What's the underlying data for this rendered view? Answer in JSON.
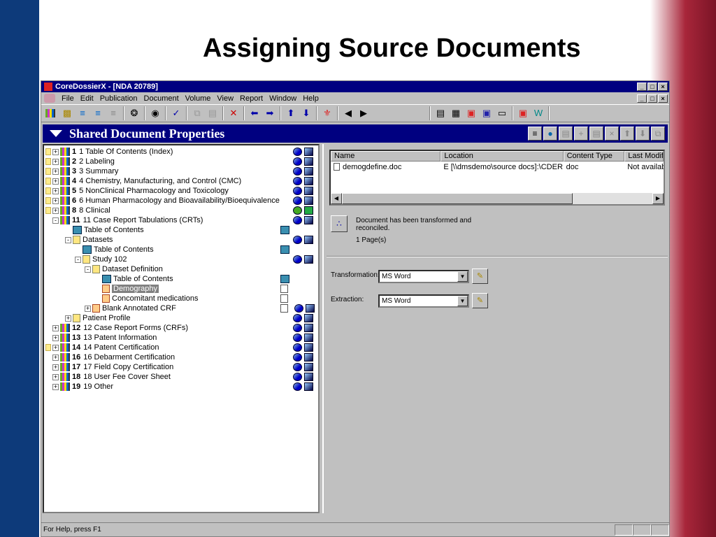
{
  "slide": {
    "title": "Assigning Source Documents"
  },
  "window": {
    "title": "CoreDossierX - [NDA 20789]",
    "controls": [
      "_",
      "ຏ",
      "×"
    ]
  },
  "menu": [
    "File",
    "Edit",
    "Publication",
    "Document",
    "Volume",
    "View",
    "Report",
    "Window",
    "Help"
  ],
  "panel": {
    "title": "Shared Document Properties"
  },
  "tree": [
    {
      "level": 0,
      "note": true,
      "num": "1",
      "label": "1 Table Of Contents (Index)",
      "icon": "volume",
      "pm": "+",
      "right": "ball-book"
    },
    {
      "level": 0,
      "note": true,
      "num": "2",
      "label": "2 Labeling",
      "icon": "volume",
      "pm": "+",
      "right": "ball-book"
    },
    {
      "level": 0,
      "note": true,
      "num": "3",
      "label": "3 Summary",
      "icon": "volume",
      "pm": "+",
      "right": "ball-book"
    },
    {
      "level": 0,
      "note": true,
      "num": "4",
      "label": "4 Chemistry, Manufacturing, and Control  (CMC)",
      "icon": "volume",
      "pm": "+",
      "right": "ball-book"
    },
    {
      "level": 0,
      "note": true,
      "num": "5",
      "label": "5 NonClinical Pharmacology and Toxicology",
      "icon": "volume",
      "pm": "+",
      "right": "ball-book"
    },
    {
      "level": 0,
      "note": true,
      "num": "6",
      "label": "6 Human Pharmacology and Bioavailability/Bioequivalence",
      "icon": "volume",
      "pm": "+",
      "right": "ball-book"
    },
    {
      "level": 0,
      "note": true,
      "num": "8",
      "label": "8 Clinical",
      "icon": "volume",
      "pm": "+",
      "right": "check-greenbook"
    },
    {
      "level": 0,
      "note": false,
      "num": "11",
      "label": "11 Case Report Tabulations (CRTs)",
      "icon": "volume",
      "pm": "-",
      "right": "ball-book"
    },
    {
      "level": 1,
      "label": "Table of Contents",
      "icon": "word",
      "right": "word"
    },
    {
      "level": 1,
      "label": "Datasets",
      "icon": "doc",
      "pm": "-",
      "right": "ball-book"
    },
    {
      "level": 2,
      "label": "Table of Contents",
      "icon": "word",
      "right": "word"
    },
    {
      "level": 2,
      "label": "Study 102",
      "icon": "doc",
      "pm": "-",
      "right": "ball-book"
    },
    {
      "level": 3,
      "label": "Dataset Definition",
      "icon": "doc",
      "pm": "-"
    },
    {
      "level": 4,
      "label": "Table of Contents",
      "icon": "word",
      "right": "word"
    },
    {
      "level": 4,
      "label": "Demography",
      "icon": "pdf",
      "selected": true,
      "right": "page"
    },
    {
      "level": 4,
      "label": "Concomitant medications",
      "icon": "pdf",
      "right": "page"
    },
    {
      "level": 3,
      "label": "Blank Annotated CRF",
      "icon": "pdf",
      "pm": "+",
      "right": "page-ball-book"
    },
    {
      "level": 1,
      "label": "Patient Profile",
      "icon": "doc",
      "pm": "+",
      "right": "ball-book"
    },
    {
      "level": 0,
      "note": false,
      "num": "12",
      "label": "12 Case Report Forms (CRFs)",
      "icon": "volume",
      "pm": "+",
      "right": "ball-book"
    },
    {
      "level": 0,
      "note": false,
      "num": "13",
      "label": "13 Patent Information",
      "icon": "volume",
      "pm": "+",
      "right": "ball-book"
    },
    {
      "level": 0,
      "note": true,
      "num": "14",
      "label": "14 Patent Certification",
      "icon": "volume",
      "pm": "+",
      "right": "ball-book"
    },
    {
      "level": 0,
      "note": false,
      "num": "16",
      "label": "16 Debarment Certification",
      "icon": "volume",
      "pm": "+",
      "right": "ball-book"
    },
    {
      "level": 0,
      "note": false,
      "num": "17",
      "label": "17 Field Copy Certification",
      "icon": "volume",
      "pm": "+",
      "right": "ball-book"
    },
    {
      "level": 0,
      "note": false,
      "num": "18",
      "label": "18 User Fee Cover Sheet",
      "icon": "volume",
      "pm": "+",
      "right": "ball-book"
    },
    {
      "level": 0,
      "note": false,
      "num": "19",
      "label": "19 Other",
      "icon": "volume",
      "pm": "+",
      "right": "ball-book"
    }
  ],
  "filelist": {
    "columns": [
      "Name",
      "Location",
      "Content Type",
      "Last Modifie"
    ],
    "rows": [
      [
        "demogdefine.doc",
        "E [\\\\dmsdemo\\source docs]:\\CDER D...",
        "doc",
        "Not available"
      ]
    ]
  },
  "status": {
    "message1": "Document has been transformed and",
    "message2": "reconciled.",
    "pages": "1 Page(s)"
  },
  "form": {
    "transformation_label": "Transformation:",
    "transformation_value": "MS Word",
    "extraction_label": "Extraction:",
    "extraction_value": "MS Word"
  },
  "statusbar": {
    "text": "For Help, press F1"
  }
}
